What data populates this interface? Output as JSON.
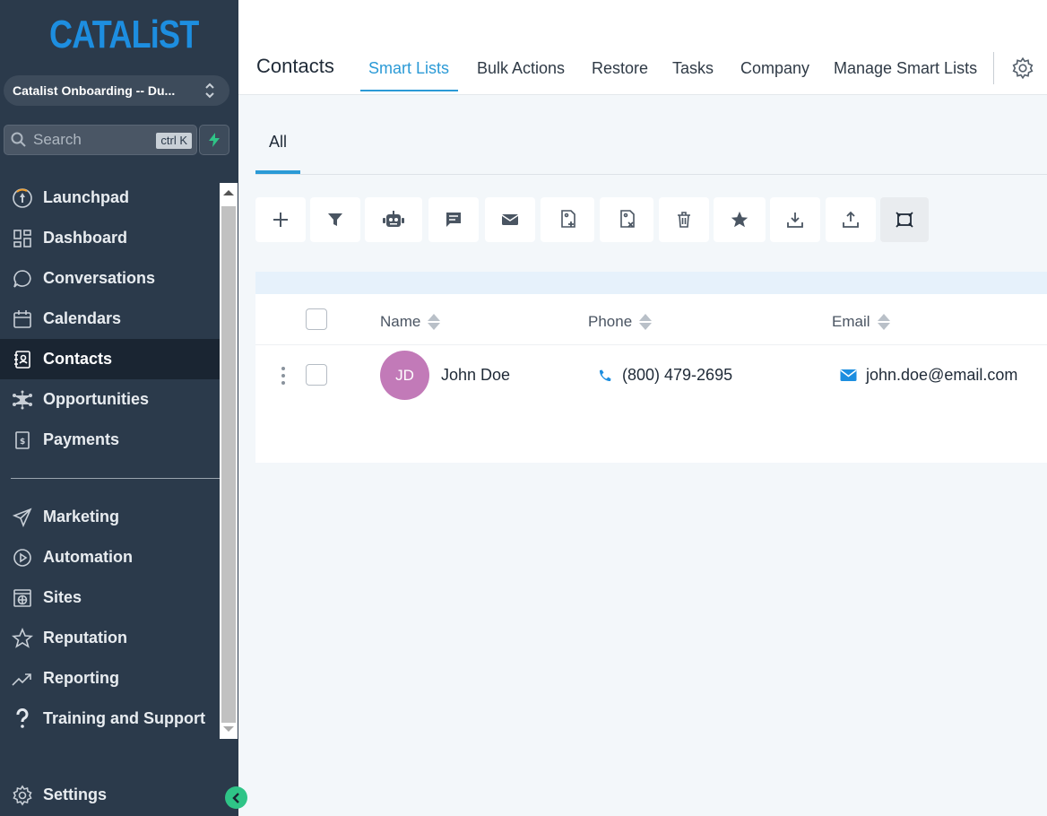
{
  "brand": {
    "logo_text": "CATALiST",
    "logo_color": "#1d8ee0"
  },
  "location": {
    "name": "Catalist Onboarding -- Du..."
  },
  "search": {
    "placeholder": "Search",
    "shortcut": "ctrl K"
  },
  "sidebar": {
    "items": [
      {
        "label": "Launchpad",
        "icon": "rocket-icon"
      },
      {
        "label": "Dashboard",
        "icon": "grid-icon"
      },
      {
        "label": "Conversations",
        "icon": "chat-icon"
      },
      {
        "label": "Calendars",
        "icon": "calendar-icon"
      },
      {
        "label": "Contacts",
        "icon": "contacts-icon",
        "active": true
      },
      {
        "label": "Opportunities",
        "icon": "network-icon"
      },
      {
        "label": "Payments",
        "icon": "invoice-icon"
      }
    ],
    "items2": [
      {
        "label": "Marketing",
        "icon": "send-icon"
      },
      {
        "label": "Automation",
        "icon": "play-circle-icon"
      },
      {
        "label": "Sites",
        "icon": "globe-icon"
      },
      {
        "label": "Reputation",
        "icon": "star-icon"
      },
      {
        "label": "Reporting",
        "icon": "trend-icon"
      },
      {
        "label": "Training and Support",
        "icon": "question-icon"
      }
    ],
    "settings": {
      "label": "Settings",
      "icon": "gear-icon"
    }
  },
  "header": {
    "title": "Contacts",
    "tabs": [
      {
        "label": "Smart Lists",
        "active": true
      },
      {
        "label": "Bulk Actions"
      },
      {
        "label": "Restore"
      },
      {
        "label": "Tasks"
      },
      {
        "label": "Company"
      },
      {
        "label": "Manage Smart Lists"
      }
    ]
  },
  "subtabs": [
    {
      "label": "All",
      "active": true
    }
  ],
  "toolbar": [
    "add-icon",
    "filter-icon",
    "robot-icon",
    "message-icon",
    "email-icon",
    "tag-add-icon",
    "tag-remove-icon",
    "trash-icon",
    "star-icon",
    "import-icon",
    "export-icon",
    "merge-icon"
  ],
  "table": {
    "columns": [
      "Name",
      "Phone",
      "Email"
    ],
    "rows": [
      {
        "initials": "JD",
        "name": "John Doe",
        "phone": "(800) 479-2695",
        "email": "john.doe@email.com"
      }
    ]
  },
  "colors": {
    "accent": "#2b9ad6",
    "sidebar_bg": "#2b3a4b",
    "avatar": "#c27ab8",
    "collapse": "#2fc487"
  }
}
